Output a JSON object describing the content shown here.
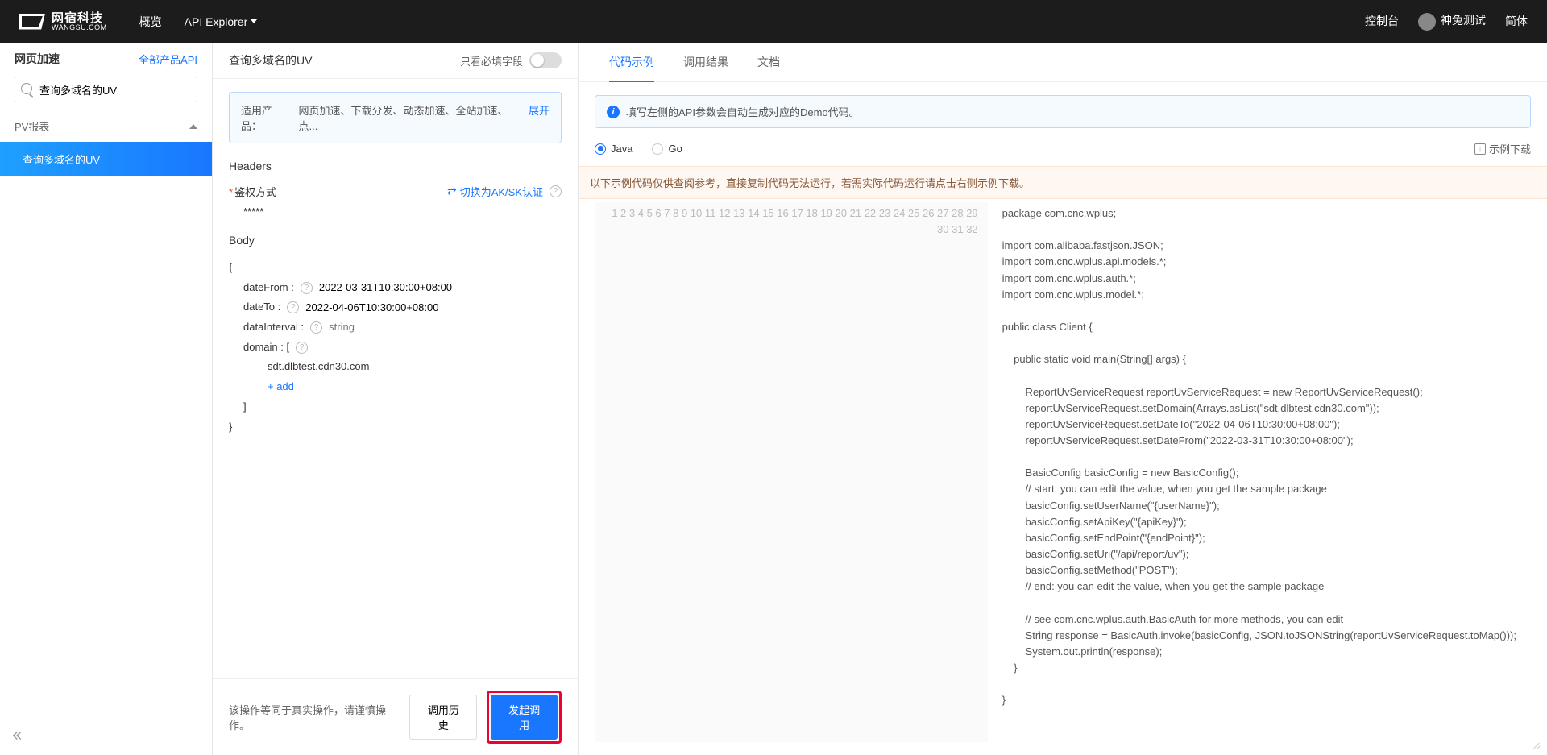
{
  "header": {
    "brand_cn": "网宿科技",
    "brand_en": "WANGSU.COM",
    "nav": {
      "overview": "概览",
      "explorer": "API Explorer"
    },
    "right": {
      "console": "控制台",
      "user": "神兔测试",
      "lang": "简体"
    }
  },
  "sidebar": {
    "title": "网页加速",
    "all_link": "全部产品API",
    "search_value": "查询多域名的UV",
    "section": "PV报表",
    "items": [
      "查询多域名的UV"
    ]
  },
  "mid": {
    "title": "查询多域名的UV",
    "toggle_label": "只看必填字段",
    "info_prefix": "适用产品：",
    "info_text": "网页加速、下载分发、动态加速、全站加速、点...",
    "expand": "展开",
    "headers_title": "Headers",
    "auth_label": "鉴权方式",
    "auth_value": "*****",
    "auth_switch": "切换为AK/SK认证",
    "body_title": "Body",
    "fields": {
      "dateFrom": {
        "label": "dateFrom :",
        "value": "2022-03-31T10:30:00+08:00"
      },
      "dateTo": {
        "label": "dateTo :",
        "value": "2022-04-06T10:30:00+08:00"
      },
      "dataInterval": {
        "label": "dataInterval :",
        "placeholder": "string"
      },
      "domain": {
        "label": "domain :  [",
        "item": "sdt.dlbtest.cdn30.com",
        "add": "+ add",
        "close": "]"
      }
    },
    "footer": {
      "warn": "该操作等同于真实操作，请谨慎操作。",
      "history": "调用历史",
      "invoke": "发起调用"
    }
  },
  "right": {
    "tabs": {
      "code": "代码示例",
      "result": "调用结果",
      "doc": "文档"
    },
    "info": "填写左侧的API参数会自动生成对应的Demo代码。",
    "langs": {
      "java": "Java",
      "go": "Go"
    },
    "download": "示例下载",
    "warn": "以下示例代码仅供查阅参考，直接复制代码无法运行，若需实际代码运行请点击右侧示例下载。",
    "code_lines": [
      "package com.cnc.wplus;",
      "",
      "import com.alibaba.fastjson.JSON;",
      "import com.cnc.wplus.api.models.*;",
      "import com.cnc.wplus.auth.*;",
      "import com.cnc.wplus.model.*;",
      "",
      "public class Client {",
      "",
      "    public static void main(String[] args) {",
      "",
      "        ReportUvServiceRequest reportUvServiceRequest = new ReportUvServiceRequest();",
      "        reportUvServiceRequest.setDomain(Arrays.asList(\"sdt.dlbtest.cdn30.com\"));",
      "        reportUvServiceRequest.setDateTo(\"2022-04-06T10:30:00+08:00\");",
      "        reportUvServiceRequest.setDateFrom(\"2022-03-31T10:30:00+08:00\");",
      "",
      "        BasicConfig basicConfig = new BasicConfig();",
      "        // start: you can edit the value, when you get the sample package",
      "        basicConfig.setUserName(\"{userName}\");",
      "        basicConfig.setApiKey(\"{apiKey}\");",
      "        basicConfig.setEndPoint(\"{endPoint}\");",
      "        basicConfig.setUri(\"/api/report/uv\");",
      "        basicConfig.setMethod(\"POST\");",
      "        // end: you can edit the value, when you get the sample package",
      "",
      "        // see com.cnc.wplus.auth.BasicAuth for more methods, you can edit",
      "        String response = BasicAuth.invoke(basicConfig, JSON.toJSONString(reportUvServiceRequest.toMap()));",
      "        System.out.println(response);",
      "    }",
      "",
      "}",
      ""
    ]
  }
}
